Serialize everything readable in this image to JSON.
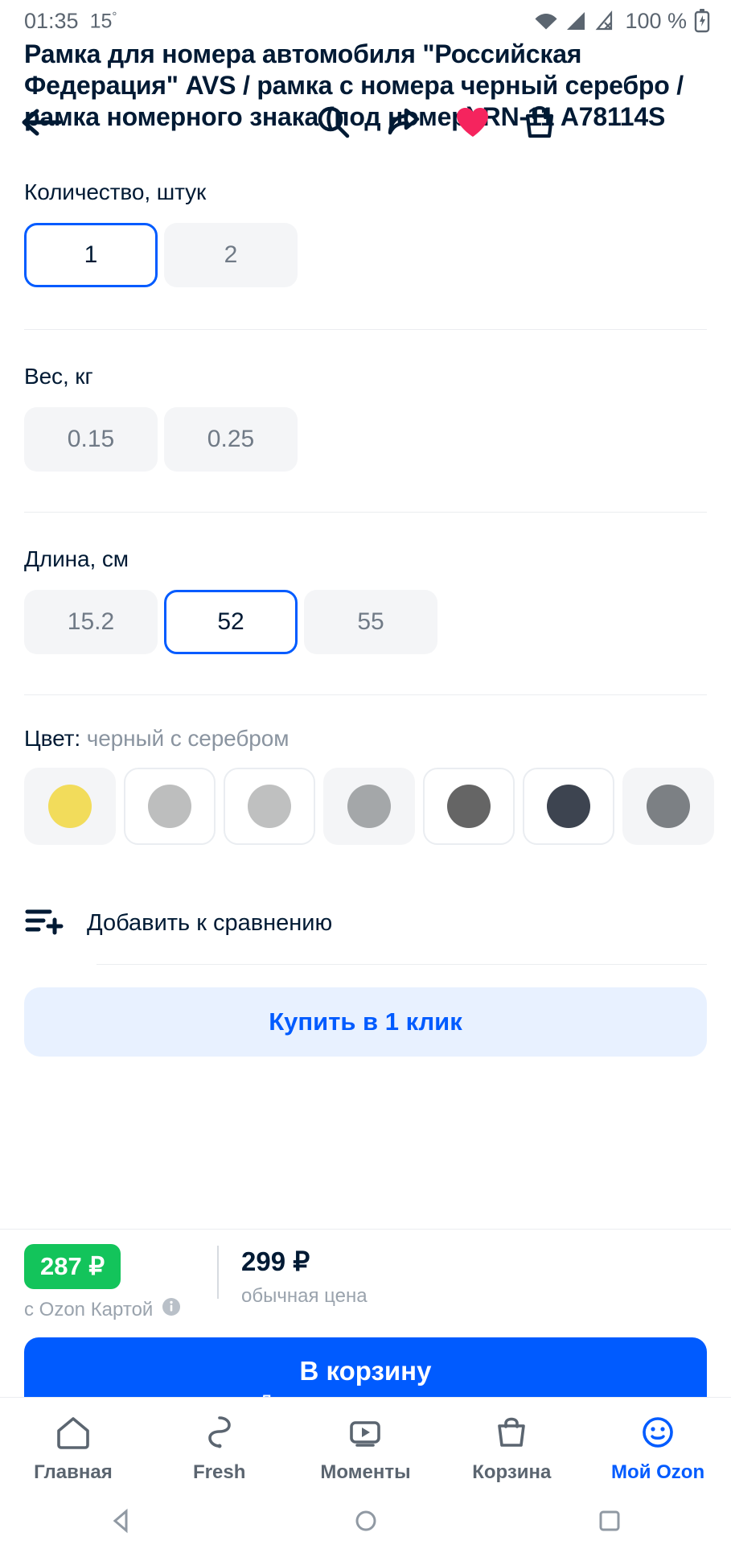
{
  "statusbar": {
    "time": "01:35",
    "temperature": "15",
    "degree_symbol": "°",
    "battery_percent": "100 %",
    "icons": [
      "wifi-icon",
      "signal-icon",
      "signal-off-icon",
      "battery-charging-icon"
    ]
  },
  "topnav": {
    "back": "back-arrow-icon",
    "search": "search-icon",
    "share": "share-icon",
    "favorite": "heart-icon",
    "favorite_color": "#F5245E",
    "cart": "cart-icon"
  },
  "product": {
    "title": "Рамка для номера автомобиля \"Российская Федерация\" AVS / рамка с номера черный серебро / рамка номерного знака (под номер) RN-11 A78114S"
  },
  "options": [
    {
      "label": "Количество, штук",
      "name": "quantity",
      "values": [
        {
          "text": "1",
          "selected": true
        },
        {
          "text": "2",
          "selected": false
        }
      ]
    },
    {
      "label": "Вес, кг",
      "name": "weight",
      "values": [
        {
          "text": "0.15",
          "selected": false
        },
        {
          "text": "0.25",
          "selected": false
        }
      ]
    },
    {
      "label": "Длина, см",
      "name": "length",
      "values": [
        {
          "text": "15.2",
          "selected": false
        },
        {
          "text": "52",
          "selected": true
        },
        {
          "text": "55",
          "selected": false
        }
      ]
    }
  ],
  "color": {
    "label_prefix": "Цвет:",
    "label_value": "черный с серебром",
    "swatches": [
      {
        "color": "#F2DC5B",
        "outline": false
      },
      {
        "color": "#BDBEBE",
        "outline": true
      },
      {
        "color": "#BFC0C0",
        "outline": true
      },
      {
        "color": "#A4A7A9",
        "outline": false
      },
      {
        "color": "#656565",
        "outline": true
      },
      {
        "color": "#3D4450",
        "outline": true
      },
      {
        "color": "#7C8084",
        "outline": false
      }
    ]
  },
  "compare": {
    "icon": "compare-add-icon",
    "label": "Добавить к сравнению"
  },
  "one_click": {
    "label": "Купить в 1 клик",
    "text_color": "#005BFF",
    "background": "#E8F1FF"
  },
  "price": {
    "card_price": "287 ₽",
    "card_badge_color": "#13C45B",
    "card_note": "с Ozon Картой",
    "info_icon": "info-icon",
    "regular_price": "299 ₽",
    "regular_note": "обычная цена"
  },
  "cart_button": {
    "title": "В корзину",
    "subtitle": "Доставим послезавтра",
    "color": "#005BFF"
  },
  "bottomnav": {
    "items": [
      {
        "label": "Главная",
        "icon": "home-icon",
        "active": false
      },
      {
        "label": "Fresh",
        "icon": "fresh-icon",
        "active": false
      },
      {
        "label": "Моменты",
        "icon": "moments-icon",
        "active": false
      },
      {
        "label": "Корзина",
        "icon": "basket-icon",
        "active": false
      },
      {
        "label": "Мой Ozon",
        "icon": "profile-icon",
        "active": true
      }
    ],
    "active_color": "#005BFF"
  },
  "androidnav": {
    "items": [
      "back-triangle-icon",
      "home-circle-icon",
      "recents-square-icon"
    ]
  }
}
